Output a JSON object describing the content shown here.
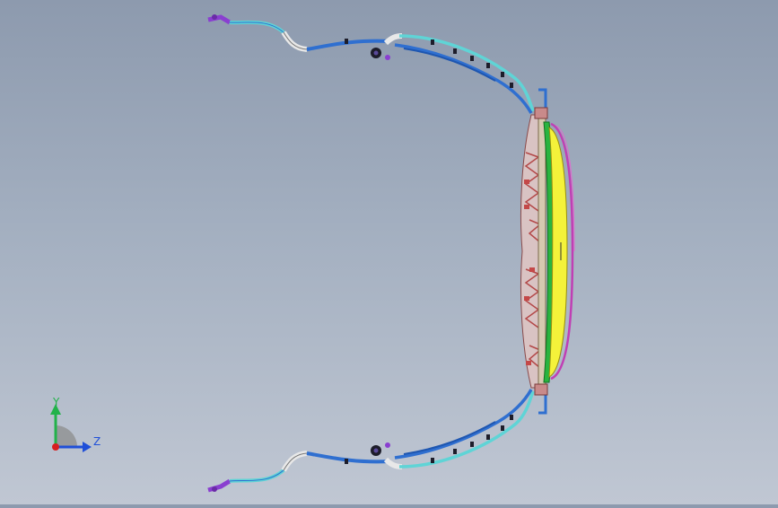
{
  "viewport": {
    "background_top": "#8d9aae",
    "background_bottom": "#c0c7d3"
  },
  "triad": {
    "y_label": "Y",
    "z_label": "Z",
    "y_color": "#22b24a",
    "z_color": "#1f4fd8",
    "x_color": "#d81f1f"
  },
  "model": {
    "description_colors": {
      "hose_light": "#5fd4d6",
      "hose_blue": "#2f6fd0",
      "hose_white": "#e8e8e8",
      "panel_yellow": "#f4f23a",
      "panel_green": "#29b43f",
      "panel_magenta": "#c03fb4",
      "fan_pink": "#c47070",
      "connector_purple": "#8a3fd0"
    }
  }
}
